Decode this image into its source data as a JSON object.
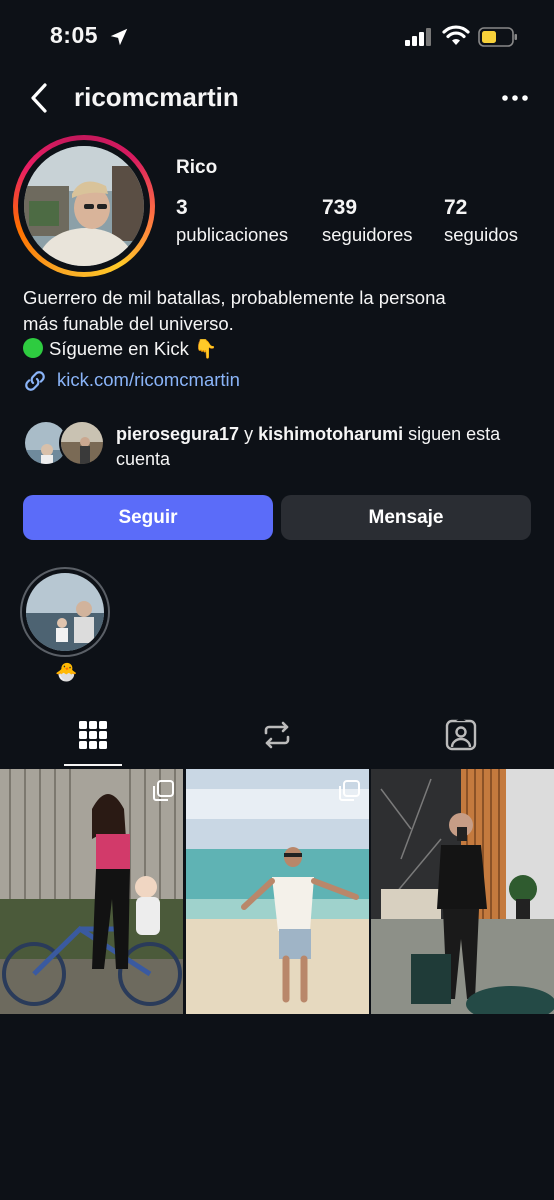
{
  "status_bar": {
    "time": "8:05",
    "icons": [
      "location-arrow-icon",
      "cellular-signal-icon",
      "wifi-icon",
      "battery-low-icon"
    ]
  },
  "header": {
    "username": "ricomcmartin",
    "back_icon": "chevron-left-icon",
    "more_icon": "ellipsis-icon"
  },
  "profile": {
    "display_name": "Rico",
    "stats": [
      {
        "value": "3",
        "label": "publicaciones"
      },
      {
        "value": "739",
        "label": "seguidores"
      },
      {
        "value": "72",
        "label": "seguidos"
      }
    ],
    "bio_lines": [
      "Guerrero de mil batallas, probablemente la persona",
      "más funable del universo.",
      "Sígueme en Kick 👇"
    ],
    "link": "kick.com/ricomcmartin"
  },
  "mutual": {
    "user1": "pierosegura17",
    "conj": " y ",
    "user2": "kishimotoharumi",
    "suffix": " siguen esta cuenta"
  },
  "actions": {
    "follow": "Seguir",
    "message": "Mensaje"
  },
  "highlights": [
    {
      "label": "🐣"
    }
  ],
  "tabs": [
    "grid-icon",
    "reposts-icon",
    "tagged-icon"
  ],
  "colors": {
    "background": "#0d1117",
    "follow_button": "#5b6cf9",
    "message_button": "#2a2d33",
    "link": "#8ab4f8",
    "battery": "#f7d13a"
  }
}
